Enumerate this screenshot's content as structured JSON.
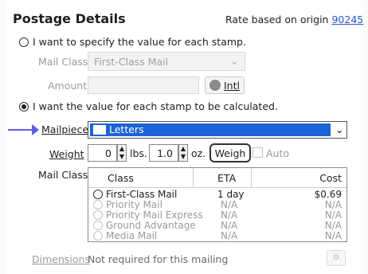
{
  "header": {
    "title": "Postage Details",
    "rate_prefix": "Rate based on origin",
    "rate_zip": "90245"
  },
  "option_specify": {
    "label": "I want to specify the value for each stamp.",
    "mail_class_label": "Mail Class",
    "mail_class_value": "First-Class Mail",
    "amount_label": "Amount",
    "intl_label": "Intl"
  },
  "option_calculate": {
    "label": "I want the value for each stamp to be calculated."
  },
  "mailpiece": {
    "label": "Mailpiece",
    "value": "Letters"
  },
  "weight": {
    "label": "Weight",
    "lbs_value": "0",
    "lbs_unit": "lbs.",
    "oz_value": "1.0",
    "oz_unit": "oz.",
    "weigh_button": "Weigh",
    "auto_label": "Auto"
  },
  "mail_class_table": {
    "label": "Mail Class",
    "columns": [
      "Class",
      "ETA",
      "Cost"
    ],
    "rows": [
      {
        "class": "First-Class Mail",
        "eta": "1 day",
        "cost": "$0.69",
        "enabled": true
      },
      {
        "class": "Priority Mail",
        "eta": "N/A",
        "cost": "N/A",
        "enabled": false
      },
      {
        "class": "Priority Mail Express",
        "eta": "N/A",
        "cost": "N/A",
        "enabled": false
      },
      {
        "class": "Ground Advantage",
        "eta": "N/A",
        "cost": "N/A",
        "enabled": false
      },
      {
        "class": "Media Mail",
        "eta": "N/A",
        "cost": "N/A",
        "enabled": false
      }
    ]
  },
  "dimensions": {
    "label": "Dimensions",
    "value": "Not required for this mailing"
  },
  "colors": {
    "selection": "#1c63d6",
    "arrow": "#5b5fe0",
    "link": "#2a53c9"
  }
}
